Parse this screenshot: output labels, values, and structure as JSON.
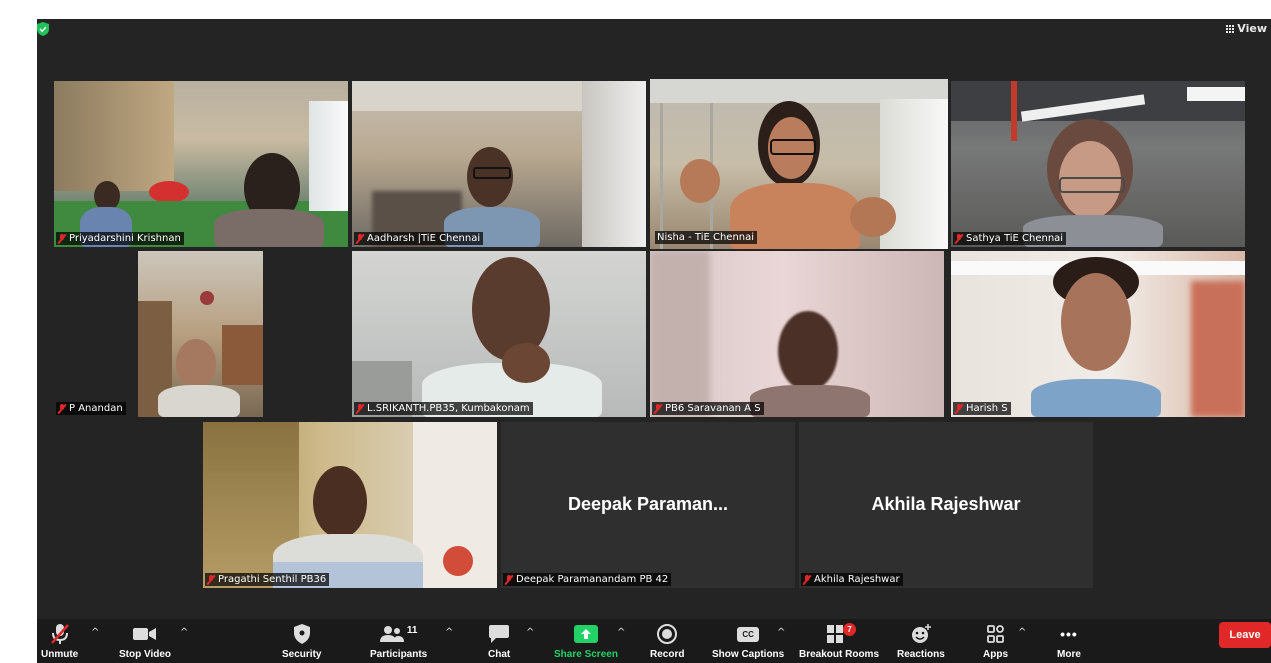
{
  "header": {
    "view_label": "View"
  },
  "participants": [
    {
      "name": "Priyadarshini Krishnan"
    },
    {
      "name": "Aadharsh |TiE Chennai"
    },
    {
      "name": "Nisha - TiE Chennai"
    },
    {
      "name": "Sathya TiE Chennai"
    },
    {
      "name": "P Anandan"
    },
    {
      "name": "L.SRIKANTH.PB35,  Kumbakonam"
    },
    {
      "name": "PB6 Saravanan A S"
    },
    {
      "name": "Harish S"
    },
    {
      "name": "Pragathi Senthil PB36"
    },
    {
      "name": "Deepak Paramanandam PB 42",
      "display": "Deepak Paraman..."
    },
    {
      "name": "Akhila Rajeshwar",
      "display": "Akhila Rajeshwar"
    }
  ],
  "toolbar": {
    "unmute": "Unmute",
    "stop_video": "Stop Video",
    "security": "Security",
    "participants": "Participants",
    "participants_count": "11",
    "chat": "Chat",
    "share_screen": "Share Screen",
    "record": "Record",
    "show_captions": "Show Captions",
    "captions_icon_text": "CC",
    "breakout_rooms": "Breakout Rooms",
    "breakout_badge": "7",
    "reactions": "Reactions",
    "apps": "Apps",
    "more": "More",
    "more_icon": "•••",
    "leave": "Leave"
  },
  "colors": {
    "speaker_outline": "#d2e36b",
    "share_green": "#22d266",
    "leave_red": "#e02828",
    "mic_off_red": "#e02828"
  }
}
